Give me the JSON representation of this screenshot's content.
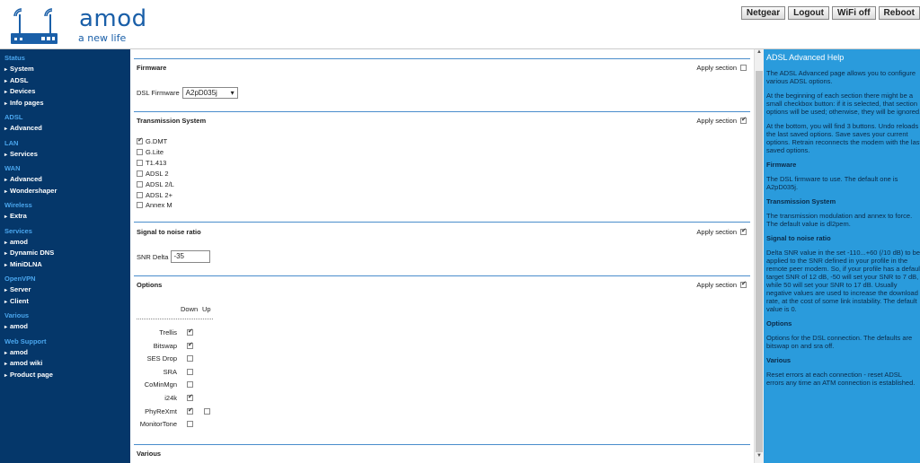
{
  "brand": {
    "name": "amod",
    "tagline": "a new life"
  },
  "top_buttons": [
    "Netgear",
    "Logout",
    "WiFi off",
    "Reboot"
  ],
  "sidebar": [
    {
      "head": "Status",
      "items": [
        "System",
        "ADSL",
        "Devices",
        "Info pages"
      ]
    },
    {
      "head": "ADSL",
      "items": [
        "Advanced"
      ]
    },
    {
      "head": "LAN",
      "items": [
        "Services"
      ]
    },
    {
      "head": "WAN",
      "items": [
        "Advanced",
        "Wondershaper"
      ]
    },
    {
      "head": "Wireless",
      "items": [
        "Extra"
      ]
    },
    {
      "head": "Services",
      "items": [
        "amod",
        "Dynamic DNS",
        "MiniDLNA"
      ]
    },
    {
      "head": "OpenVPN",
      "items": [
        "Server",
        "Client"
      ]
    },
    {
      "head": "Various",
      "items": [
        "amod"
      ]
    },
    {
      "head": "Web Support",
      "items": [
        "amod",
        "amod wiki",
        "Product page"
      ]
    }
  ],
  "main": {
    "apply_label": "Apply section",
    "firmware": {
      "title": "Firmware",
      "label": "DSL Firmware",
      "value": "A2pD035j",
      "apply": false
    },
    "transmission": {
      "title": "Transmission System",
      "apply": true,
      "modes": [
        {
          "label": "G.DMT",
          "checked": true
        },
        {
          "label": "G.Lite",
          "checked": false
        },
        {
          "label": "T1.413",
          "checked": false
        },
        {
          "label": "ADSL 2",
          "checked": false
        },
        {
          "label": "ADSL 2/L",
          "checked": false
        },
        {
          "label": "ADSL 2+",
          "checked": false
        },
        {
          "label": "Annex M",
          "checked": false
        }
      ]
    },
    "snr": {
      "title": "Signal to noise ratio",
      "label": "SNR Delta",
      "value": "-35",
      "apply": true
    },
    "options": {
      "title": "Options",
      "apply": true,
      "col_down": "Down",
      "col_up": "Up",
      "rows": [
        {
          "label": "Trellis",
          "down": true,
          "up": null
        },
        {
          "label": "Bitswap",
          "down": true,
          "up": null
        },
        {
          "label": "SES Drop",
          "down": false,
          "up": null
        },
        {
          "label": "SRA",
          "down": false,
          "up": null
        },
        {
          "label": "CoMinMgn",
          "down": false,
          "up": null
        },
        {
          "label": "i24k",
          "down": true,
          "up": null
        },
        {
          "label": "PhyReXmt",
          "down": true,
          "up": false
        },
        {
          "label": "MonitorTone",
          "down": false,
          "up": null
        }
      ]
    },
    "various": {
      "title": "Various"
    }
  },
  "help": {
    "title": "ADSL Advanced Help",
    "blocks": [
      {
        "type": "p",
        "lines": [
          "The ADSL Advanced page allows you to configure",
          "various ADSL options."
        ]
      },
      {
        "type": "p",
        "lines": [
          "At the beginning of each section there might be a",
          "small checkbox button: if it is selected, that section",
          "options will be used; otherwise, they will be ignored."
        ]
      },
      {
        "type": "p",
        "lines": [
          "At the bottom, you will find 3 buttons. Undo reloads",
          "the last saved options. Save saves your current",
          "options. Retrain reconnects the modem with the last",
          "saved options."
        ]
      },
      {
        "type": "h",
        "lines": [
          "Firmware"
        ]
      },
      {
        "type": "p",
        "lines": [
          "The DSL firmware to use. The default one is",
          "A2pD035j."
        ]
      },
      {
        "type": "h",
        "lines": [
          "Transmission System"
        ]
      },
      {
        "type": "p",
        "lines": [
          "The transmission modulation and annex to force.",
          "The default value is dl2pem."
        ]
      },
      {
        "type": "h",
        "lines": [
          "Signal to noise ratio"
        ]
      },
      {
        "type": "p",
        "lines": [
          "Delta SNR value in the set -110...+60 (/10 dB) to be",
          "applied to the SNR defined in your profile in the",
          "remote peer modem. So, if your profile has a default",
          "target SNR of 12 dB, -50 will set your SNR to 7 dB,",
          "while 50 will set your SNR to 17 dB. Usually",
          "negative values are used to increase the download",
          "rate, at the cost of some link instability. The default",
          "value is 0."
        ]
      },
      {
        "type": "h",
        "lines": [
          "Options"
        ]
      },
      {
        "type": "p",
        "lines": [
          "Options for the DSL connection. The defaults are",
          "bitswap on and sra off."
        ]
      },
      {
        "type": "h",
        "lines": [
          "Various"
        ]
      },
      {
        "type": "p",
        "lines": [
          "Reset errors at each connection - reset ADSL",
          "errors any time an ATM connection is established."
        ]
      }
    ]
  }
}
